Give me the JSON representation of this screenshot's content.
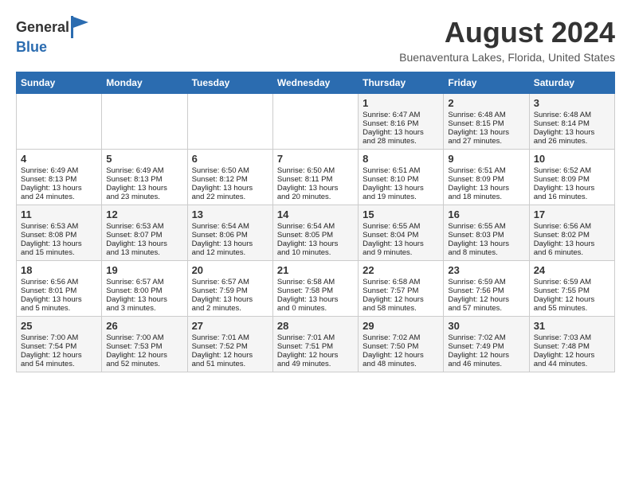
{
  "header": {
    "logo_general": "General",
    "logo_blue": "Blue",
    "month": "August 2024",
    "location": "Buenaventura Lakes, Florida, United States"
  },
  "columns": [
    "Sunday",
    "Monday",
    "Tuesday",
    "Wednesday",
    "Thursday",
    "Friday",
    "Saturday"
  ],
  "rows": [
    [
      {
        "day": "",
        "info": ""
      },
      {
        "day": "",
        "info": ""
      },
      {
        "day": "",
        "info": ""
      },
      {
        "day": "",
        "info": ""
      },
      {
        "day": "1",
        "info": "Sunrise: 6:47 AM\nSunset: 8:16 PM\nDaylight: 13 hours\nand 28 minutes."
      },
      {
        "day": "2",
        "info": "Sunrise: 6:48 AM\nSunset: 8:15 PM\nDaylight: 13 hours\nand 27 minutes."
      },
      {
        "day": "3",
        "info": "Sunrise: 6:48 AM\nSunset: 8:14 PM\nDaylight: 13 hours\nand 26 minutes."
      }
    ],
    [
      {
        "day": "4",
        "info": "Sunrise: 6:49 AM\nSunset: 8:13 PM\nDaylight: 13 hours\nand 24 minutes."
      },
      {
        "day": "5",
        "info": "Sunrise: 6:49 AM\nSunset: 8:13 PM\nDaylight: 13 hours\nand 23 minutes."
      },
      {
        "day": "6",
        "info": "Sunrise: 6:50 AM\nSunset: 8:12 PM\nDaylight: 13 hours\nand 22 minutes."
      },
      {
        "day": "7",
        "info": "Sunrise: 6:50 AM\nSunset: 8:11 PM\nDaylight: 13 hours\nand 20 minutes."
      },
      {
        "day": "8",
        "info": "Sunrise: 6:51 AM\nSunset: 8:10 PM\nDaylight: 13 hours\nand 19 minutes."
      },
      {
        "day": "9",
        "info": "Sunrise: 6:51 AM\nSunset: 8:09 PM\nDaylight: 13 hours\nand 18 minutes."
      },
      {
        "day": "10",
        "info": "Sunrise: 6:52 AM\nSunset: 8:09 PM\nDaylight: 13 hours\nand 16 minutes."
      }
    ],
    [
      {
        "day": "11",
        "info": "Sunrise: 6:53 AM\nSunset: 8:08 PM\nDaylight: 13 hours\nand 15 minutes."
      },
      {
        "day": "12",
        "info": "Sunrise: 6:53 AM\nSunset: 8:07 PM\nDaylight: 13 hours\nand 13 minutes."
      },
      {
        "day": "13",
        "info": "Sunrise: 6:54 AM\nSunset: 8:06 PM\nDaylight: 13 hours\nand 12 minutes."
      },
      {
        "day": "14",
        "info": "Sunrise: 6:54 AM\nSunset: 8:05 PM\nDaylight: 13 hours\nand 10 minutes."
      },
      {
        "day": "15",
        "info": "Sunrise: 6:55 AM\nSunset: 8:04 PM\nDaylight: 13 hours\nand 9 minutes."
      },
      {
        "day": "16",
        "info": "Sunrise: 6:55 AM\nSunset: 8:03 PM\nDaylight: 13 hours\nand 8 minutes."
      },
      {
        "day": "17",
        "info": "Sunrise: 6:56 AM\nSunset: 8:02 PM\nDaylight: 13 hours\nand 6 minutes."
      }
    ],
    [
      {
        "day": "18",
        "info": "Sunrise: 6:56 AM\nSunset: 8:01 PM\nDaylight: 13 hours\nand 5 minutes."
      },
      {
        "day": "19",
        "info": "Sunrise: 6:57 AM\nSunset: 8:00 PM\nDaylight: 13 hours\nand 3 minutes."
      },
      {
        "day": "20",
        "info": "Sunrise: 6:57 AM\nSunset: 7:59 PM\nDaylight: 13 hours\nand 2 minutes."
      },
      {
        "day": "21",
        "info": "Sunrise: 6:58 AM\nSunset: 7:58 PM\nDaylight: 13 hours\nand 0 minutes."
      },
      {
        "day": "22",
        "info": "Sunrise: 6:58 AM\nSunset: 7:57 PM\nDaylight: 12 hours\nand 58 minutes."
      },
      {
        "day": "23",
        "info": "Sunrise: 6:59 AM\nSunset: 7:56 PM\nDaylight: 12 hours\nand 57 minutes."
      },
      {
        "day": "24",
        "info": "Sunrise: 6:59 AM\nSunset: 7:55 PM\nDaylight: 12 hours\nand 55 minutes."
      }
    ],
    [
      {
        "day": "25",
        "info": "Sunrise: 7:00 AM\nSunset: 7:54 PM\nDaylight: 12 hours\nand 54 minutes."
      },
      {
        "day": "26",
        "info": "Sunrise: 7:00 AM\nSunset: 7:53 PM\nDaylight: 12 hours\nand 52 minutes."
      },
      {
        "day": "27",
        "info": "Sunrise: 7:01 AM\nSunset: 7:52 PM\nDaylight: 12 hours\nand 51 minutes."
      },
      {
        "day": "28",
        "info": "Sunrise: 7:01 AM\nSunset: 7:51 PM\nDaylight: 12 hours\nand 49 minutes."
      },
      {
        "day": "29",
        "info": "Sunrise: 7:02 AM\nSunset: 7:50 PM\nDaylight: 12 hours\nand 48 minutes."
      },
      {
        "day": "30",
        "info": "Sunrise: 7:02 AM\nSunset: 7:49 PM\nDaylight: 12 hours\nand 46 minutes."
      },
      {
        "day": "31",
        "info": "Sunrise: 7:03 AM\nSunset: 7:48 PM\nDaylight: 12 hours\nand 44 minutes."
      }
    ]
  ]
}
